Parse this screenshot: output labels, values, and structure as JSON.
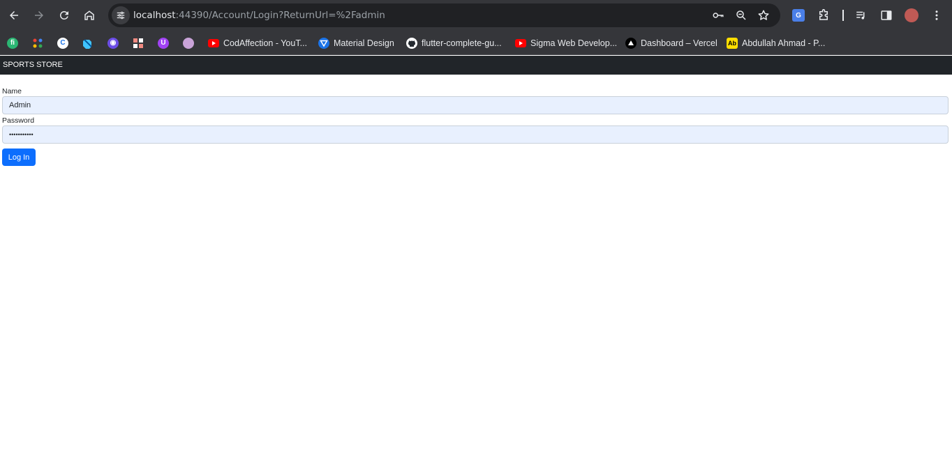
{
  "browser": {
    "url_host": "localhost",
    "url_rest": ":44390/Account/Login?ReturnUrl=%2Fadmin",
    "bookmarks": [
      {
        "label": "CodAffection - YouT...",
        "icon": "youtube-icon",
        "color": "#ff0000"
      },
      {
        "label": "Material Design",
        "icon": "material-design-icon",
        "color": "#1a73e8"
      },
      {
        "label": "flutter-complete-gu...",
        "icon": "github-icon",
        "color": "#ffffff"
      },
      {
        "label": "Sigma Web Develop...",
        "icon": "youtube-icon",
        "color": "#ff0000"
      },
      {
        "label": "Dashboard – Vercel",
        "icon": "vercel-icon",
        "color": "#000000"
      },
      {
        "label": "Abdullah Ahmad - P...",
        "icon": "ab-icon",
        "color": "#ffde00"
      }
    ],
    "ab_glyph": "Ab"
  },
  "page": {
    "brand": "SPORTS STORE",
    "name_label": "Name",
    "name_value": "Admin",
    "password_label": "Password",
    "password_value": "•••••••••••",
    "login_label": "Log In",
    "accent_color": "#0d6efd",
    "navbar_color": "#212529"
  }
}
